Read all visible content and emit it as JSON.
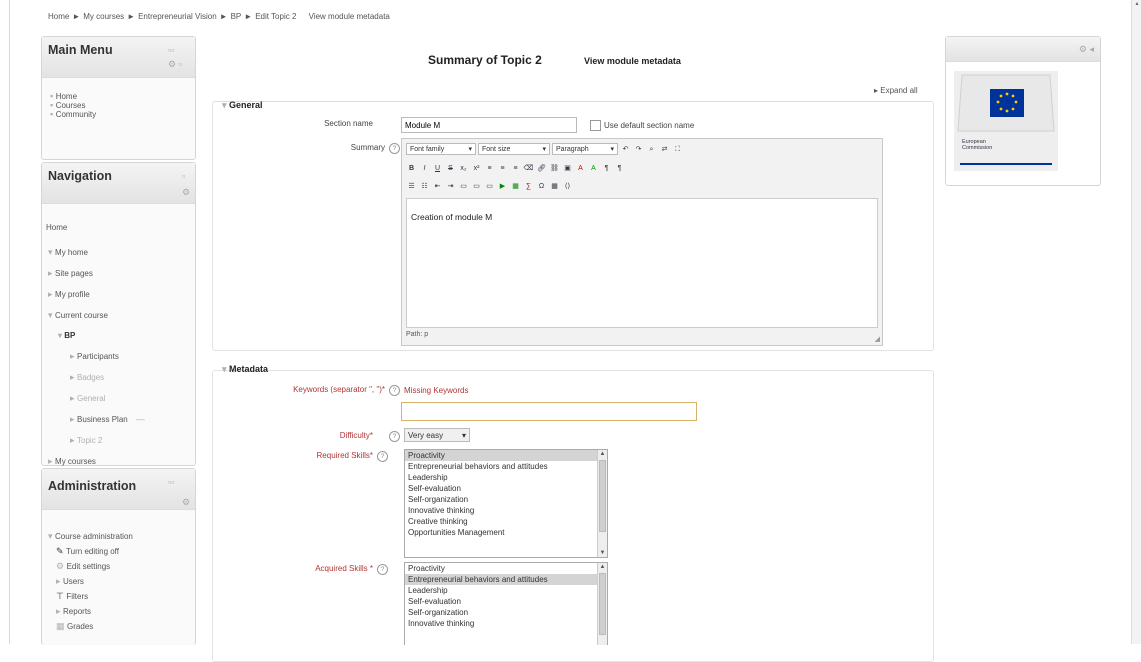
{
  "breadcrumb": {
    "items": [
      "Home",
      "My courses",
      "Entrepreneurial Vision",
      "BP",
      "Edit Topic 2"
    ],
    "separator": "►",
    "trailing": "View module metadata"
  },
  "main_menu": {
    "title": "Main Menu",
    "items": [
      "Home",
      "Courses",
      "Community"
    ]
  },
  "navigation": {
    "title": "Navigation",
    "home": "Home",
    "items": [
      "My home",
      "Site pages",
      "My profile",
      "Current course"
    ],
    "course": "BP",
    "course_items": [
      "Participants",
      "Badges",
      "General",
      "Business Plan",
      "Topic 2"
    ],
    "my_courses": "My courses"
  },
  "administration": {
    "title": "Administration",
    "course_admin": "Course administration",
    "items": [
      "Turn editing off",
      "Edit settings",
      "Users",
      "Filters",
      "Reports",
      "Grades"
    ]
  },
  "page": {
    "title": "Summary of Topic 2",
    "subtitle": "View module metadata",
    "expand_all": "Expand all"
  },
  "general": {
    "legend": "General",
    "section_name_label": "Section name",
    "section_name_value": "Module M",
    "use_default_label": "Use default section name",
    "summary_label": "Summary",
    "toolbar": {
      "font_family": "Font family",
      "font_size": "Font size",
      "paragraph": "Paragraph"
    },
    "editor_content": "Creation of module M",
    "path": "Path: p"
  },
  "metadata": {
    "legend": "Metadata",
    "keywords_label": "Keywords (separator \", \")*",
    "keywords_error": "Missing Keywords",
    "keywords_value": "",
    "difficulty_label": "Difficulty*",
    "difficulty_value": "Very easy",
    "required_skills_label": "Required Skills*",
    "required_skills": [
      "Proactivity",
      "Entrepreneurial behaviors and attitudes",
      "Leadership",
      "Self-evaluation",
      "Self-organization",
      "Innovative thinking",
      "Creative thinking",
      "Opportunities Management"
    ],
    "acquired_skills_label": "Acquired Skills *",
    "acquired_skills": [
      "Proactivity",
      "Entrepreneurial behaviors and attitudes",
      "Leadership",
      "Self-evaluation",
      "Self-organization",
      "Innovative thinking"
    ]
  },
  "right_block": {
    "logo_text": "European Commission",
    "flag_color": "#003399",
    "star_color": "#ffcc00"
  },
  "colors": {
    "required_label": "#b03535",
    "error_text": "#b03535",
    "keyword_input_border": "#d8b26a"
  }
}
